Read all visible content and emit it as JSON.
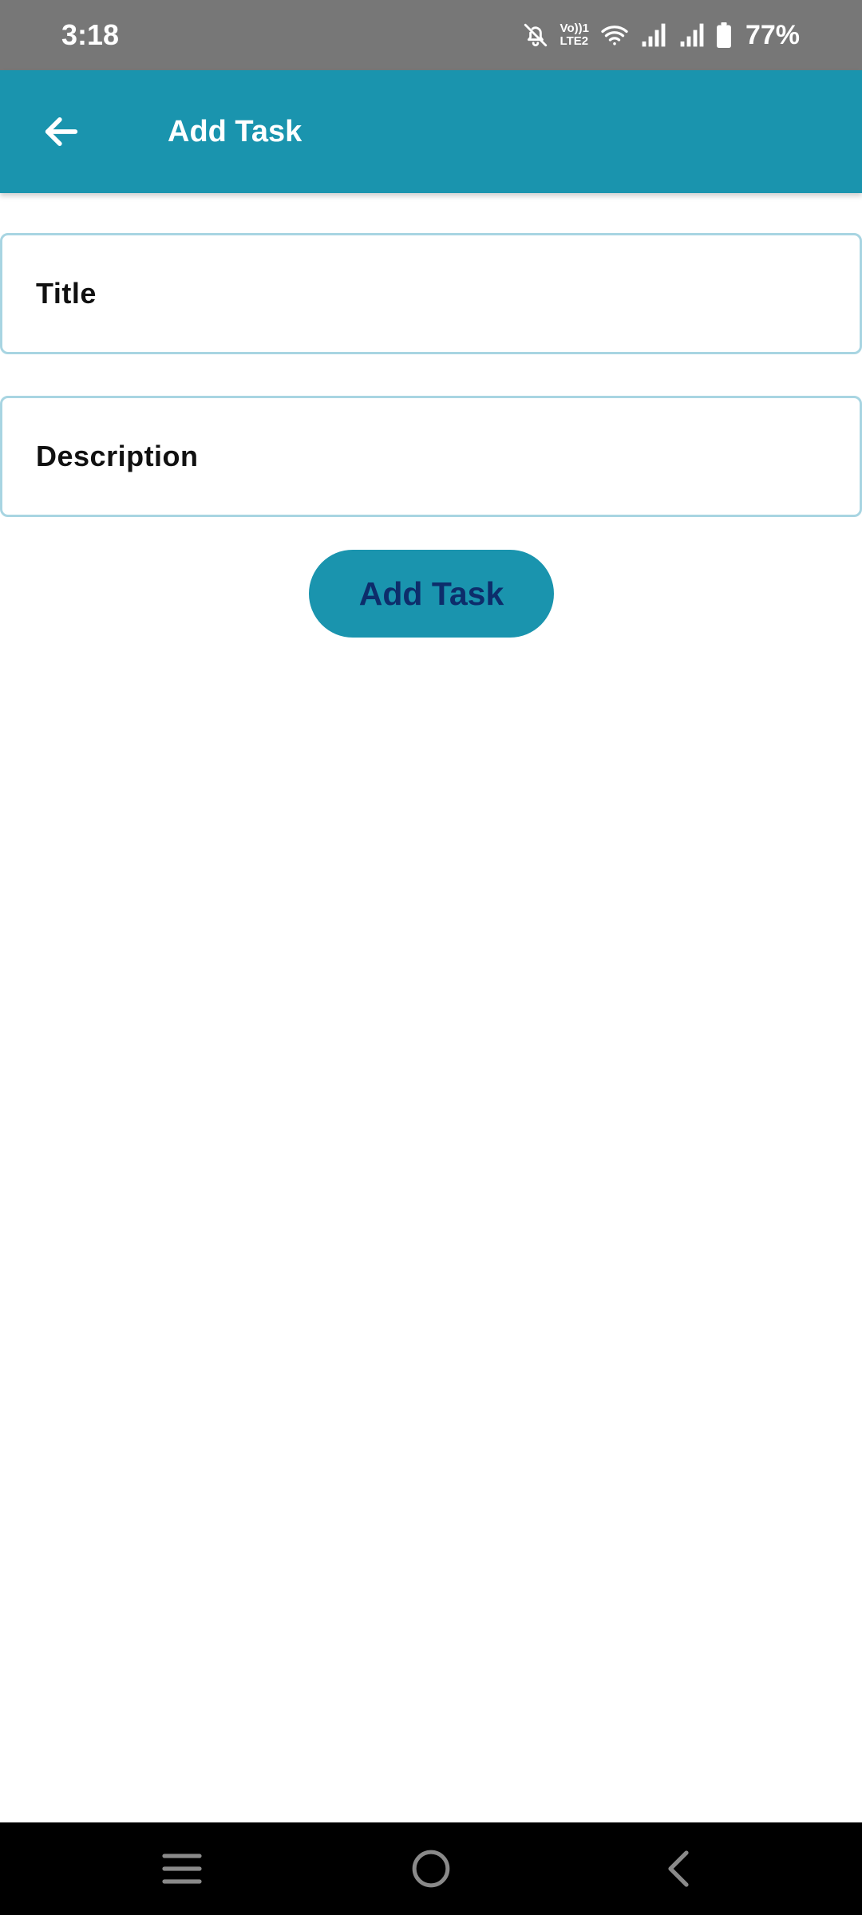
{
  "status_bar": {
    "time": "3:18",
    "network_label_top": "Vo))1",
    "network_label_bottom": "LTE2",
    "battery_percent": "77%",
    "icons": [
      "bell-off-icon",
      "volte-icon",
      "wifi-icon",
      "signal-icon",
      "signal-icon",
      "battery-icon"
    ]
  },
  "app_bar": {
    "title": "Add Task",
    "back_icon": "arrow-left-icon"
  },
  "form": {
    "title_placeholder": "Title",
    "title_value": "",
    "description_placeholder": "Description",
    "description_value": "",
    "submit_label": "Add Task"
  },
  "nav_bar": {
    "icons": [
      "recents-icon",
      "home-icon",
      "back-icon"
    ]
  },
  "colors": {
    "accent": "#1a94ae",
    "status_bar": "#777777",
    "field_border": "#a8d5e2",
    "button_text": "#0d2d6b"
  }
}
